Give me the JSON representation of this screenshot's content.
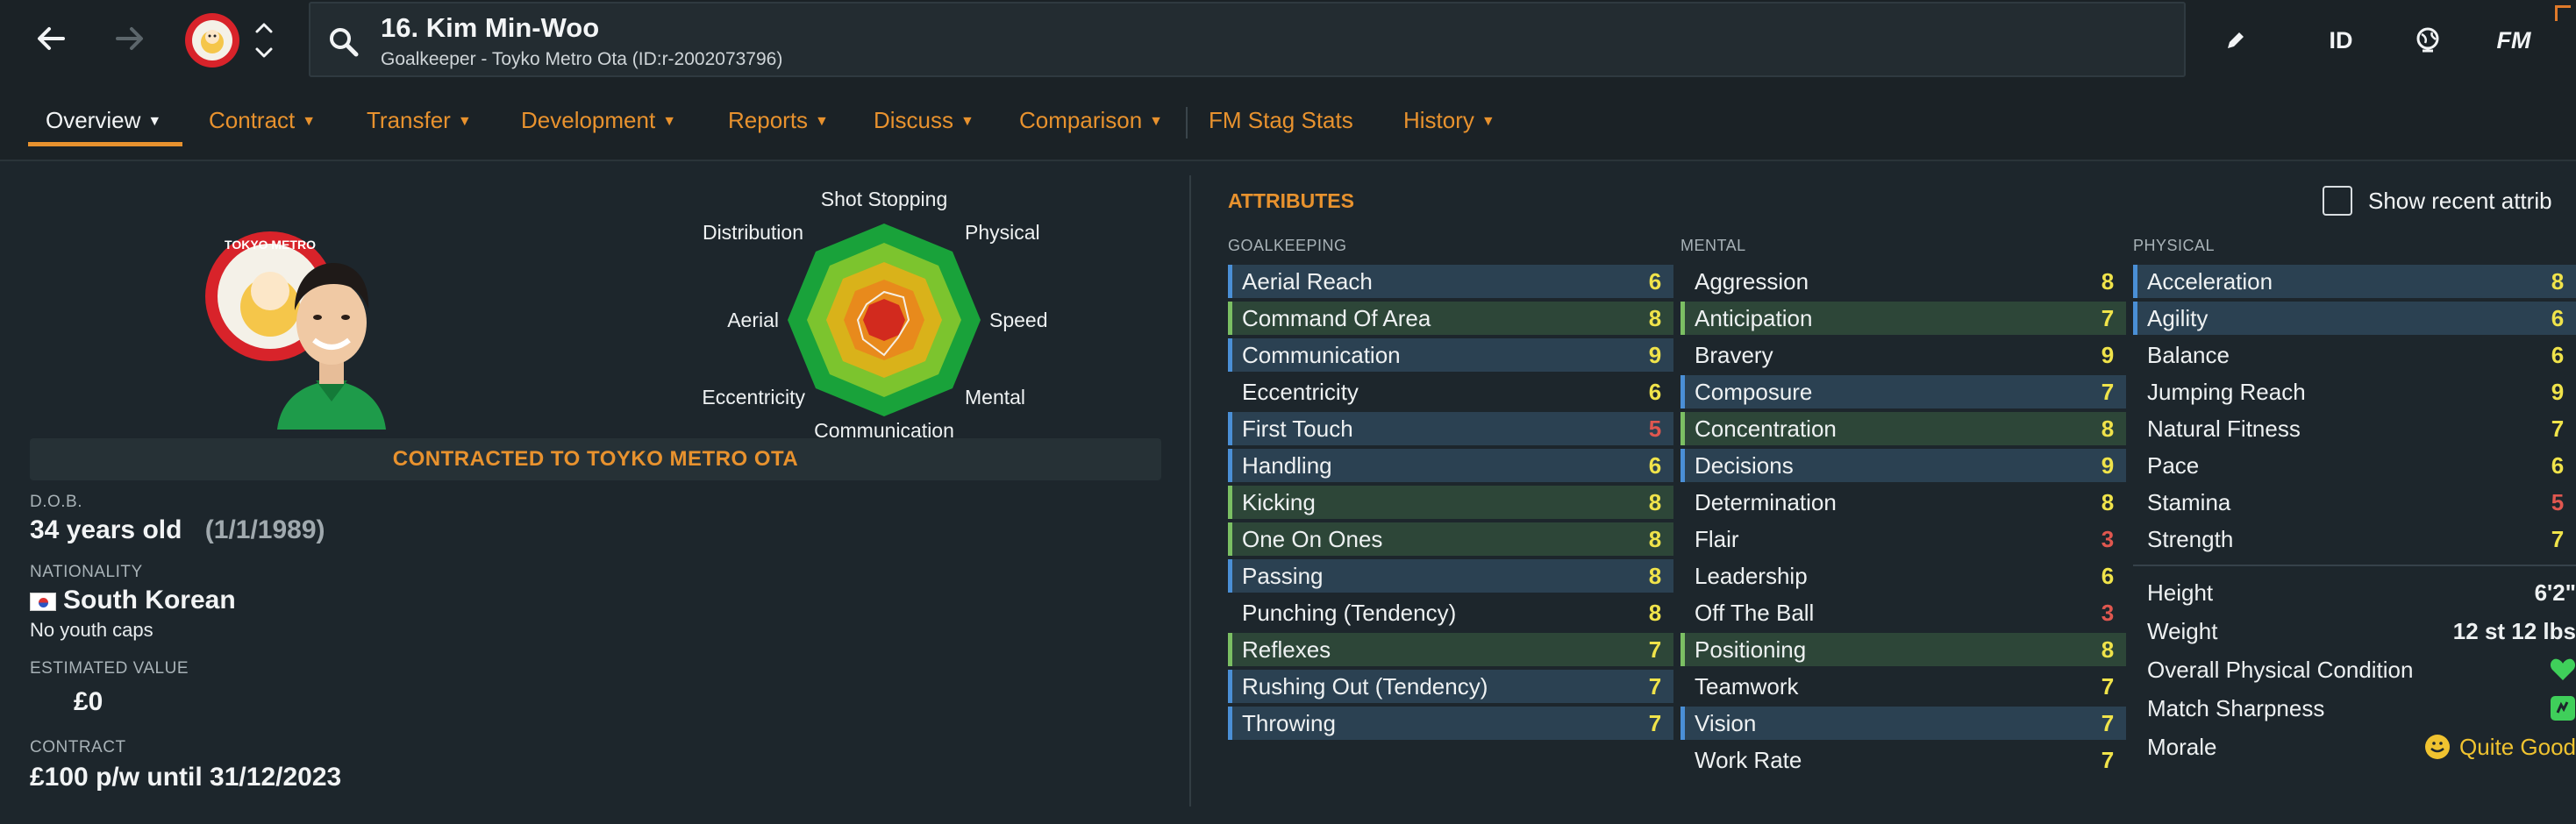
{
  "header": {
    "title": "16. Kim Min-Woo",
    "subtitle": "Goalkeeper - Toyko Metro Ota (ID:r-2002073796)",
    "right_icons": [
      "edit-icon",
      "ID",
      "world-icon",
      "FM"
    ]
  },
  "tabs": [
    {
      "label": "Overview",
      "active": true
    },
    {
      "label": "Contract"
    },
    {
      "label": "Transfer"
    },
    {
      "label": "Development"
    },
    {
      "label": "Reports"
    },
    {
      "label": "Discuss"
    },
    {
      "label": "Comparison"
    },
    {
      "label": "FM Stag Stats"
    },
    {
      "label": "History"
    }
  ],
  "radar": {
    "labels": {
      "top": "Shot Stopping",
      "top_right": "Physical",
      "right": "Speed",
      "bottom_right": "Mental",
      "bottom": "Communication",
      "bottom_left": "Eccentricity",
      "left": "Aerial",
      "top_left": "Distribution"
    }
  },
  "profile": {
    "contract_banner": "CONTRACTED TO TOYKO METRO OTA",
    "dob_label": "D.O.B.",
    "age": "34 years old",
    "dob": "(1/1/1989)",
    "nationality_label": "NATIONALITY",
    "nationality": "South Korean",
    "youth_caps": "No youth caps",
    "value_label": "ESTIMATED VALUE",
    "value": "£0",
    "contract_label": "CONTRACT",
    "contract": "£100 p/w until 31/12/2023"
  },
  "attributes": {
    "title": "ATTRIBUTES",
    "show_recent": "Show recent attrib",
    "goalkeeping_label": "GOALKEEPING",
    "mental_label": "MENTAL",
    "physical_label": "PHYSICAL",
    "goalkeeping": [
      {
        "name": "Aerial Reach",
        "value": "6"
      },
      {
        "name": "Command Of Area",
        "value": "8"
      },
      {
        "name": "Communication",
        "value": "9"
      },
      {
        "name": "Eccentricity",
        "value": "6"
      },
      {
        "name": "First Touch",
        "value": "5"
      },
      {
        "name": "Handling",
        "value": "6"
      },
      {
        "name": "Kicking",
        "value": "8"
      },
      {
        "name": "One On Ones",
        "value": "8"
      },
      {
        "name": "Passing",
        "value": "8"
      },
      {
        "name": "Punching (Tendency)",
        "value": "8"
      },
      {
        "name": "Reflexes",
        "value": "7"
      },
      {
        "name": "Rushing Out (Tendency)",
        "value": "7"
      },
      {
        "name": "Throwing",
        "value": "7"
      }
    ],
    "mental": [
      {
        "name": "Aggression",
        "value": "8"
      },
      {
        "name": "Anticipation",
        "value": "7"
      },
      {
        "name": "Bravery",
        "value": "9"
      },
      {
        "name": "Composure",
        "value": "7"
      },
      {
        "name": "Concentration",
        "value": "8"
      },
      {
        "name": "Decisions",
        "value": "9"
      },
      {
        "name": "Determination",
        "value": "8"
      },
      {
        "name": "Flair",
        "value": "3"
      },
      {
        "name": "Leadership",
        "value": "6"
      },
      {
        "name": "Off The Ball",
        "value": "3"
      },
      {
        "name": "Positioning",
        "value": "8"
      },
      {
        "name": "Teamwork",
        "value": "7"
      },
      {
        "name": "Vision",
        "value": "7"
      },
      {
        "name": "Work Rate",
        "value": "7"
      }
    ],
    "physical": [
      {
        "name": "Acceleration",
        "value": "8"
      },
      {
        "name": "Agility",
        "value": "6"
      },
      {
        "name": "Balance",
        "value": "6"
      },
      {
        "name": "Jumping Reach",
        "value": "9"
      },
      {
        "name": "Natural Fitness",
        "value": "7"
      },
      {
        "name": "Pace",
        "value": "6"
      },
      {
        "name": "Stamina",
        "value": "5"
      },
      {
        "name": "Strength",
        "value": "7"
      }
    ],
    "info": {
      "height_label": "Height",
      "height": "6'2\"",
      "weight_label": "Weight",
      "weight": "12 st 12 lbs",
      "condition_label": "Overall Physical Condition",
      "sharpness_label": "Match Sharpness",
      "morale_label": "Morale",
      "morale": "Quite Good"
    }
  },
  "colors": {
    "accent": "#e8922e",
    "value_high": "#f0e34a",
    "value_low": "#e0574f",
    "highlight_blue": "#4a8fd6",
    "highlight_green": "#7bbf63"
  }
}
